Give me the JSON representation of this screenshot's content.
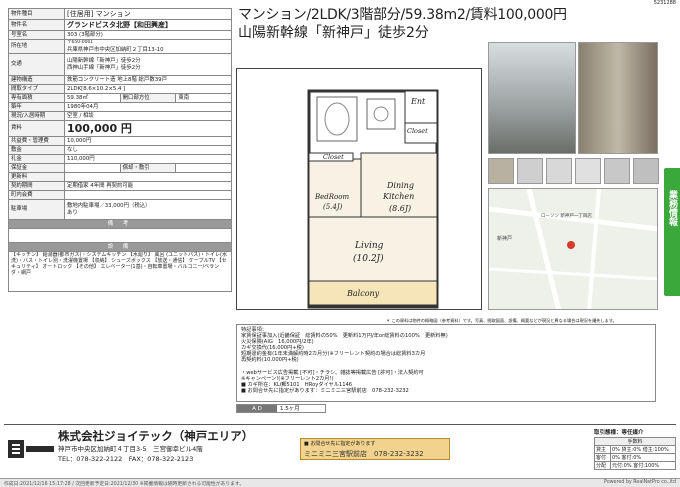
{
  "corner_code": "5231288",
  "title_line1": "マンション/2LDK/3階部分/59.38m2/賃料100,000円",
  "title_line2": "山陽新幹線「新神戸」徒歩2分",
  "table": {
    "type_label": "物件種目",
    "type_value": "[住居用] マンション",
    "name_label": "物件名",
    "name_value": "グランドビスタ北野【和田興産】",
    "room_label": "号室名",
    "room_value": "303 (3階部分)",
    "address_label": "所在地",
    "zip": "〒650-0001",
    "address": "兵庫県神戸市中央区加納町２丁目13-10",
    "transit_label": "交通",
    "transit1": "山陽新幹線「新神戸」徒歩2分",
    "transit2": "西神山手線「新神戸」徒歩2分",
    "structure_label": "建物構造",
    "structure_value": "鉄筋コンクリート造 地上8階 総戸数39戸",
    "layout_label": "間取タイプ",
    "layout_value": "2LDK[8.6×10.2×5.4 ]",
    "area_label": "専有面積",
    "area_value": "59.38㎡",
    "direction_label": "開口部方位",
    "direction_value": "東南",
    "built_label": "築年",
    "built_value": "1980年04月",
    "status_label": "現況/入居時期",
    "status_value": "空室 / 相談",
    "rent_label": "賃料",
    "rent_value": "100,000 円",
    "fee_label": "共益費・管理費",
    "fee_value": "10,000円",
    "shiki_label": "敷金",
    "shiki_value": "なし",
    "rei_label": "礼金",
    "rei_value": "110,000円",
    "hosho_label": "保証金",
    "shokyaku_label": "償却・敷引",
    "renewal_label": "更新料",
    "contract_label": "契約期間",
    "contract_value": "定期借家 4年間 再契約可能",
    "parking_label": "駐車場",
    "parking_value1": "敷地内駐車場／33,000円（税込）",
    "parking_value2": "あり",
    "parking_sub_label": "町内会費",
    "notes_header": "備 考",
    "facility_header": "設 備",
    "facility_text": "【キッチン】 給湯器(都市ガス)・システムキッチン 【水廻り】 風呂 (ユニットバス)・トイレ(水洗)・バス・トイレ別・洗濯機置場 【収納】 シューズボックス 【放送・通信】 ケーブルTV 【セキュリティ】 オートロック 【その他】 エレベーター(1基)・自転車置場・バルコニー/ベランダ・網戸"
  },
  "floorplan": {
    "ent": "Ent",
    "closet1": "Closet",
    "closet2": "Closet",
    "bedroom": "BedRoom",
    "bedroom_size": "(5.4J)",
    "dining": "Dining",
    "kitchen": "Kitchen",
    "dk_size": "(8.6J)",
    "living": "Living",
    "living_size": "(10.2J)",
    "balcony": "Balcony"
  },
  "map_caption": "＊ この資料は物件の概略図（参考資料）です。写真、間取図面、設備、概要などが現況と異なる場合は現況を優先します。",
  "map_labels": {
    "shop": "ローソン 新神戸一丁目店",
    "station": "新神戸"
  },
  "notes_text": [
    "特記事項：",
    "家賃保証事加入(近畿保証　総賃料の50%　更新料1万円/年or総賃料の100%　更新料無)",
    "火災保険(AIG　16,000円/2年)",
    "カギ交換代(16,000円+税)",
    "短期違約金有(1年未満解約時2カ月分)※フリーレント契約の場合は総賃料3カ月",
    "再契約料(10,000円+税)",
    "",
    "・webサービス広告掲載 [不可]・チラシ、雑誌等掲載広告 [許可]・法人契約可",
    "※キャンペーン!(※フリーレント2カ月!)",
    "■ カギ所在：KLi郵5101　HRoyダイヤル1146",
    "■ お問合せ先に指定があります：ミニミニ三宮駅前店　078-232-3232"
  ],
  "ad_label": "A D",
  "ad_value": "1.5ヶ月",
  "side_tab": "業務情報",
  "company": "株式会社ジョイテック（神戸エリア）",
  "company_address": "神戸市中央区加納町４丁目3-5　三宮御幸ビル4階",
  "company_tel": "TEL：078-322-2122　FAX：078-322-2123",
  "shop_note": "■ お問合せ先に指定があります",
  "shop_name": "ミニミニ三宮駅前店　078-232-3232",
  "deal": {
    "title": "取引態様：専任媒介",
    "fee_header": "手数料",
    "kashi_label": "貸主",
    "kashi_value": "0% 貸主:0% 借主:100%",
    "kyakuzuke_label": "客付",
    "kyakuzuke_value": "0% 客付:0%",
    "bunpai_label": "分配",
    "bunpai_value": "元付:0% 客付:100%"
  },
  "bottom_left": "作成日:2021/12/16 15:17:28 / 次回更新予定日:2021/12/30 ※掲載情報は随時更新される可能性があります。",
  "bottom_right": "Powered by RealNetPro co.,ltd"
}
